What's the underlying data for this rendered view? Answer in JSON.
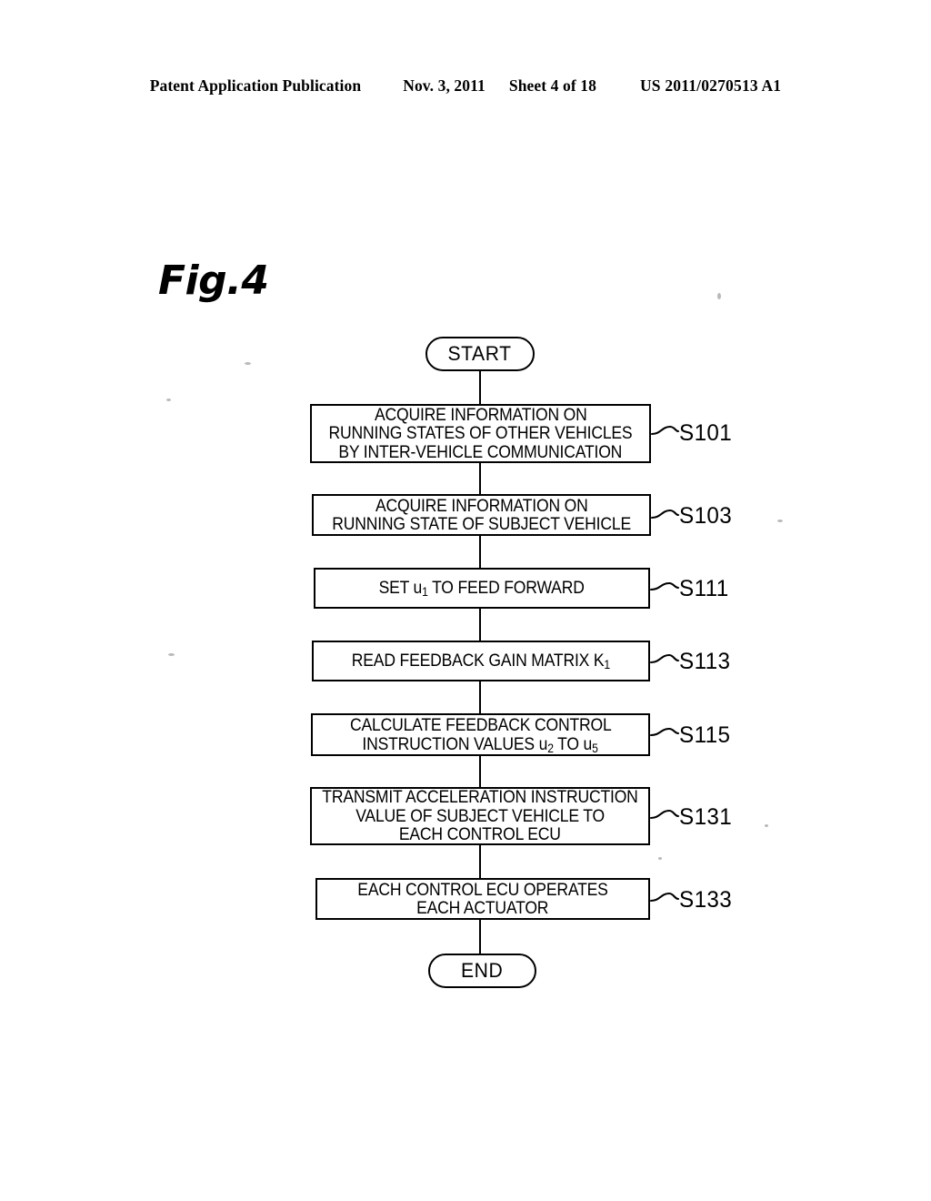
{
  "header": {
    "publication": "Patent Application Publication",
    "date": "Nov. 3, 2011",
    "sheet": "Sheet 4 of 18",
    "patent_number": "US 2011/0270513 A1"
  },
  "figure": {
    "label": "Fig.4"
  },
  "flowchart": {
    "start_label": "START",
    "end_label": "END",
    "steps": [
      {
        "id": "S101",
        "lines": [
          "ACQUIRE INFORMATION ON",
          "RUNNING STATES OF OTHER VEHICLES",
          "BY INTER-VEHICLE COMMUNICATION"
        ]
      },
      {
        "id": "S103",
        "lines": [
          "ACQUIRE INFORMATION ON",
          "RUNNING STATE OF SUBJECT VEHICLE"
        ]
      },
      {
        "id": "S111",
        "lines": [
          "SET u1 TO FEED FORWARD"
        ],
        "line_html": [
          "SET u<sub>1</sub> TO FEED FORWARD"
        ]
      },
      {
        "id": "S113",
        "lines": [
          "READ FEEDBACK GAIN MATRIX K1"
        ],
        "line_html": [
          "READ FEEDBACK GAIN MATRIX K<sub>1</sub>"
        ]
      },
      {
        "id": "S115",
        "lines": [
          "CALCULATE FEEDBACK CONTROL",
          "INSTRUCTION VALUES u2 TO u5"
        ],
        "line_html": [
          "CALCULATE FEEDBACK CONTROL",
          "INSTRUCTION VALUES u<sub>2</sub> TO u<sub>5</sub>"
        ]
      },
      {
        "id": "S131",
        "lines": [
          "TRANSMIT ACCELERATION INSTRUCTION",
          "VALUE OF SUBJECT VEHICLE TO",
          "EACH CONTROL ECU"
        ]
      },
      {
        "id": "S133",
        "lines": [
          "EACH CONTROL ECU OPERATES",
          "EACH ACTUATOR"
        ]
      }
    ]
  },
  "colors": {
    "ink": "#000000",
    "paper": "#ffffff"
  }
}
